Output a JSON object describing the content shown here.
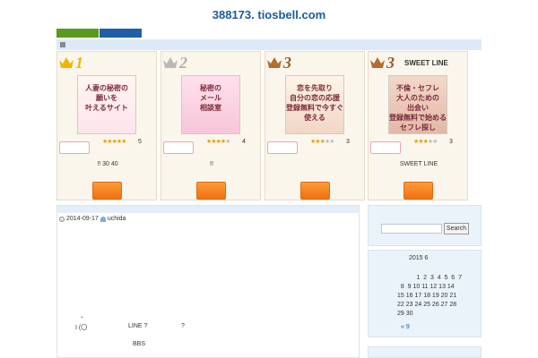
{
  "site": {
    "title": "388173. tiosbell.com"
  },
  "ranking": [
    {
      "rank": "1",
      "title": "",
      "thumb_lines": [
        "人妻の秘密の",
        "願いを",
        "叶えるサイト"
      ],
      "stars_on": 5,
      "rating": "5",
      "desc": "!! 30  40",
      "crown_color": "#f2b400",
      "num_color": "#f2b400"
    },
    {
      "rank": "2",
      "title": "",
      "thumb_lines": [
        "秘密の",
        "メール",
        "相談室"
      ],
      "stars_on": 4,
      "rating": "4",
      "desc": "!!",
      "crown_color": "#b8b8b8",
      "num_color": "#b0b0b0"
    },
    {
      "rank": "3",
      "title": "",
      "thumb_lines": [
        "恋を先取り",
        "自分の恋の応援",
        "登録無料で今すぐ使える"
      ],
      "stars_on": 3,
      "rating": "3",
      "desc": "",
      "crown_color": "#b86a30",
      "num_color": "#9a5a2a"
    },
    {
      "rank": "3",
      "title": "SWEET LINE",
      "thumb_lines": [
        "不倫・セフレ",
        "大人のための",
        "出会い",
        "登録無料で始めるセフレ探し"
      ],
      "stars_on": 3,
      "rating": "3",
      "desc": "SWEET LINE",
      "crown_color": "#b86a30",
      "num_color": "#9a5a2a"
    }
  ],
  "post": {
    "date": "2014-09-17",
    "author": "uchida",
    "line1": "、",
    "line2a": "I (〇",
    "line2b": "LINE  ?",
    "line2c": "?",
    "line3": "BBS"
  },
  "sidebar": {
    "search_button": "Search",
    "calendar_title": "2015 6",
    "calendar_rows": [
      "           1  2  3  4  5  6  7",
      "  8  9 10 11 12 13 14",
      "15 16 17 18 19 20 21",
      "22 23 24 25 26 27 28",
      "29 30"
    ],
    "prev_link": "« 9"
  },
  "colors": {
    "accent": "#1a5aa0",
    "cta": "#f07010",
    "nav_green": "#5a9a1e",
    "nav_blue": "#1e5fa8"
  }
}
